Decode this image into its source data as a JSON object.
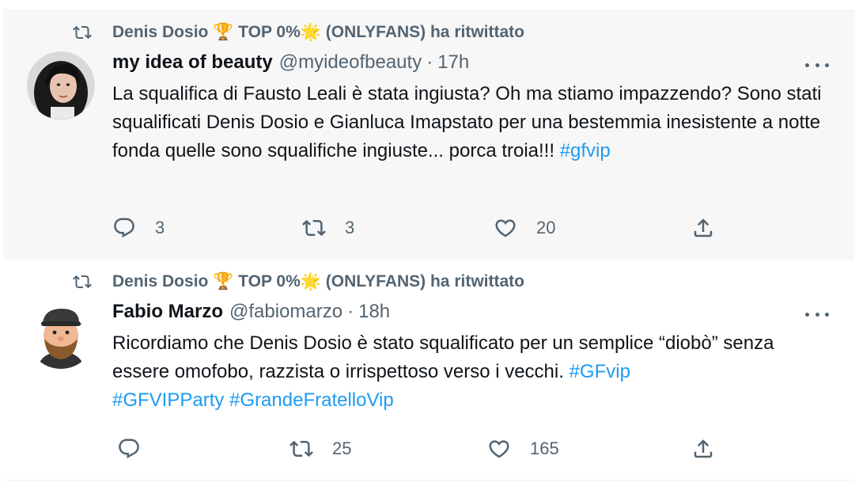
{
  "tweets": [
    {
      "retweeted_by": "Denis Dosio 🏆 TOP 0%🌟 (ONLYFANS) ha ritwittato",
      "author_name": "my idea of beauty",
      "handle": "@myideofbeauty",
      "separator": "·",
      "time": "17h",
      "text_plain": "La squalifica di Fausto Leali è stata ingiusta? Oh ma stiamo impazzendo? Sono stati squalificati  Denis Dosio e Gianluca Imapstato per una bestemmia inesistente a notte fonda quelle sono squalifiche ingiuste... porca troia!!! ",
      "hashtags": [
        "#gfvip"
      ],
      "replies": "3",
      "retweets": "3",
      "likes": "20",
      "avatar_icon": "woman-avatar"
    },
    {
      "retweeted_by": "Denis Dosio 🏆 TOP 0%🌟 (ONLYFANS) ha ritwittato",
      "author_name": "Fabio Marzo",
      "handle": "@fabiomarzo",
      "separator": "·",
      "time": "18h",
      "text_plain": "Ricordiamo che Denis Dosio è stato squalificato per un semplice “diobò” senza essere omofobo, razzista o irrispettoso verso i vecchi. ",
      "hashtags": [
        "#GFvip",
        "#GFVIPParty",
        "#GrandeFratelloVip"
      ],
      "replies": "",
      "retweets": "25",
      "likes": "165",
      "avatar_icon": "cartoon-man-avatar"
    }
  ],
  "colors": {
    "text": "#0f1419",
    "secondary": "#536471",
    "link": "#1d9bf0",
    "card_bg": "#f7f7f7"
  }
}
